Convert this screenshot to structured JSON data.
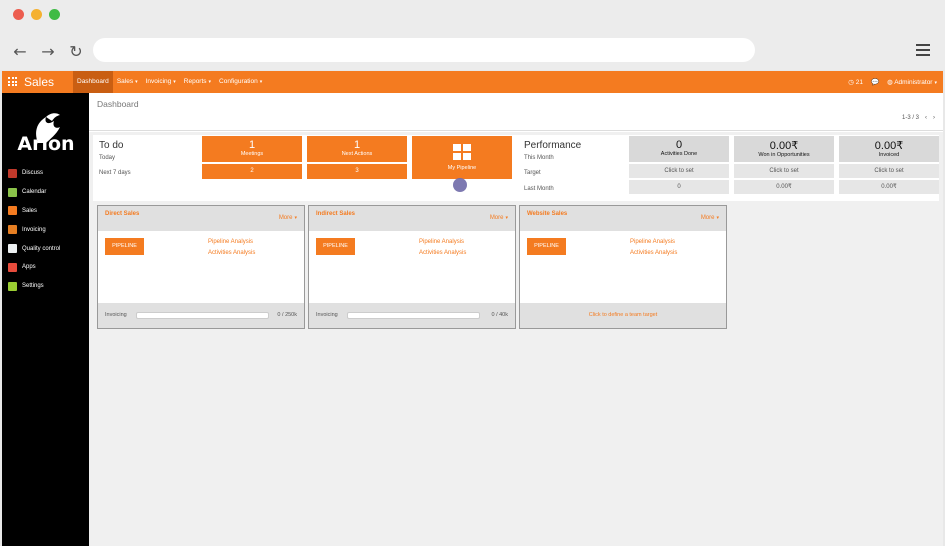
{
  "colors": {
    "accent": "#f47b20",
    "sidebar": "#000000"
  },
  "topbar": {
    "app_title": "Sales",
    "menu": [
      {
        "label": "Dashboard",
        "active": true,
        "caret": false
      },
      {
        "label": "Sales",
        "caret": true
      },
      {
        "label": "Invoicing",
        "caret": true
      },
      {
        "label": "Reports",
        "caret": true
      },
      {
        "label": "Configuration",
        "caret": true
      }
    ],
    "messages_count": "21",
    "user": "Administrator"
  },
  "sidebar": {
    "logo_text": "Arion",
    "items": [
      {
        "label": "Discuss",
        "color": "#c0392b"
      },
      {
        "label": "Calendar",
        "color": "#8bc34a"
      },
      {
        "label": "Sales",
        "color": "#f47b20"
      },
      {
        "label": "Invoicing",
        "color": "#e67e22"
      },
      {
        "label": "Quality control",
        "color": "#ecf0f1"
      },
      {
        "label": "Apps",
        "color": "#e74c3c"
      },
      {
        "label": "Settings",
        "color": "#9acd32"
      }
    ]
  },
  "breadcrumb": "Dashboard",
  "pager": "1-3 / 3",
  "todo": {
    "title": "To do",
    "today_label": "Today",
    "next_label": "Next 7 days",
    "meetings": {
      "today": "1",
      "label": "Meetings",
      "next": "2"
    },
    "actions": {
      "today": "1",
      "label": "Next Actions",
      "next": "3"
    },
    "pipeline_label": "My Pipeline"
  },
  "performance": {
    "title": "Performance",
    "this_month": "This Month",
    "target": "Target",
    "last_month": "Last Month",
    "cols": [
      {
        "value": "0",
        "label": "Activities Done",
        "target": "Click to set",
        "last": "0"
      },
      {
        "value": "0.00₹",
        "label": "Won in Opportunities",
        "target": "Click to set",
        "last": "0.00₹"
      },
      {
        "value": "0.00₹",
        "label": "Invoiced",
        "target": "Click to set",
        "last": "0.00₹"
      }
    ]
  },
  "teams": [
    {
      "title": "Direct Sales",
      "more": "More",
      "pipeline": "PIPELINE",
      "link1": "Pipeline Analysis",
      "link2": "Activities Analysis",
      "footer_label": "Invoicing",
      "footer_value": "0 / 250k",
      "progress": 0
    },
    {
      "title": "Indirect Sales",
      "more": "More",
      "pipeline": "PIPELINE",
      "link1": "Pipeline Analysis",
      "link2": "Activities Analysis",
      "footer_label": "Invoicing",
      "footer_value": "0 / 40k",
      "progress": 0
    },
    {
      "title": "Website Sales",
      "more": "More",
      "pipeline": "PIPELINE",
      "link1": "Pipeline Analysis",
      "link2": "Activities Analysis",
      "footer_target": "Click to define a team target"
    }
  ]
}
